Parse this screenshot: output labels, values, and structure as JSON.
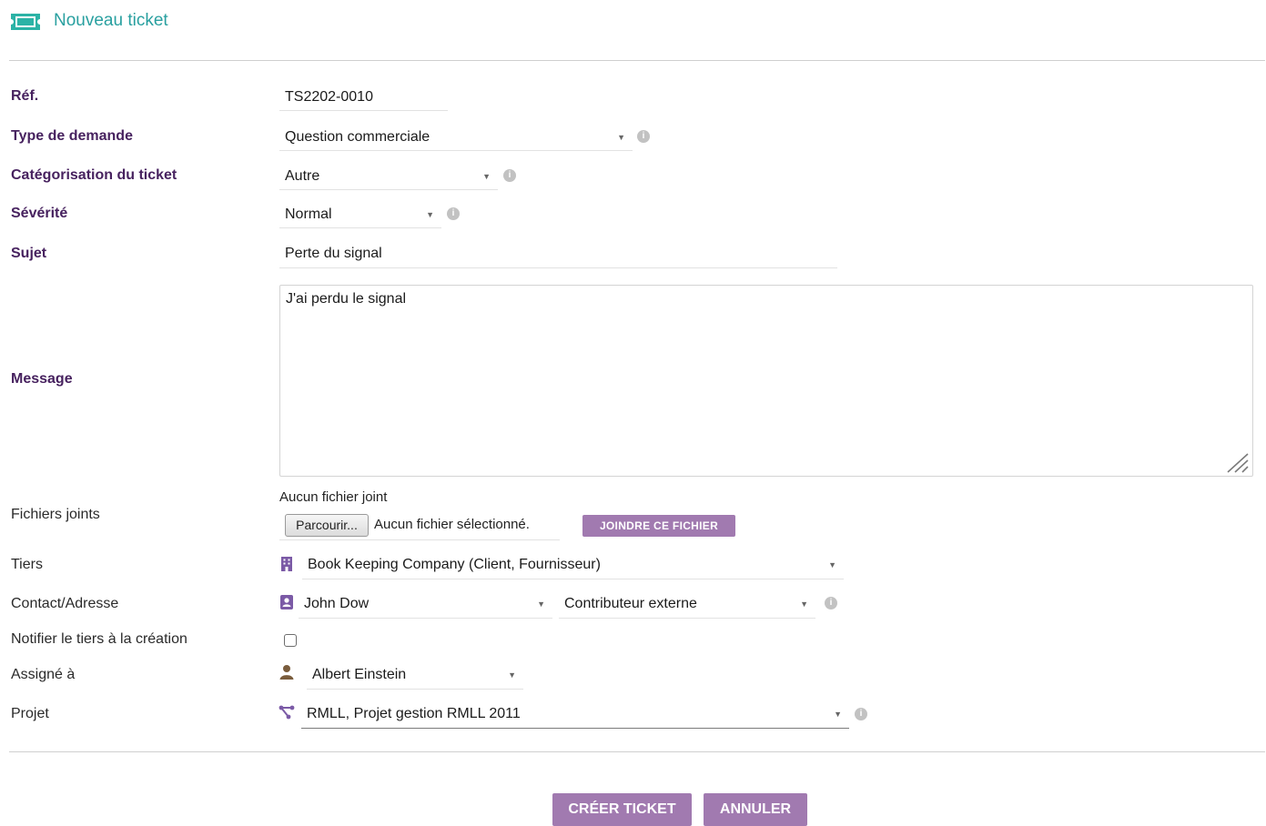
{
  "header": {
    "title": "Nouveau ticket",
    "icon": "ticket-icon",
    "accent": "#29a0a0"
  },
  "form": {
    "ref": {
      "label": "Réf.",
      "value": "TS2202-0010"
    },
    "type_demande": {
      "label": "Type de demande",
      "value": "Question commerciale"
    },
    "categorisation": {
      "label": "Catégorisation du ticket",
      "value": "Autre"
    },
    "severite": {
      "label": "Sévérité",
      "value": "Normal"
    },
    "sujet": {
      "label": "Sujet",
      "value": "Perte du signal"
    },
    "message": {
      "label": "Message",
      "value": "J'ai perdu le signal"
    },
    "fichiers": {
      "label": "Fichiers joints",
      "status": "Aucun fichier joint",
      "browse_label": "Parcourir...",
      "no_file": "Aucun fichier sélectionné.",
      "join_label": "JOINDRE CE FICHIER"
    },
    "tiers": {
      "label": "Tiers",
      "value": "Book Keeping Company (Client, Fournisseur)",
      "icon": "building-icon"
    },
    "contact": {
      "label": "Contact/Adresse",
      "value": "John Dow",
      "role": "Contributeur externe",
      "icon": "contact-card-icon"
    },
    "notifier": {
      "label": "Notifier le tiers à la création",
      "checked": false
    },
    "assigne": {
      "label": "Assigné à",
      "value": "Albert Einstein",
      "icon": "user-icon"
    },
    "projet": {
      "label": "Projet",
      "value": "RMLL, Projet gestion RMLL 2011",
      "icon": "project-icon"
    }
  },
  "actions": {
    "create_label": "CRÉER TICKET",
    "cancel_label": "ANNULER",
    "button_color": "#a17ab0"
  },
  "colors": {
    "required_label": "#47225f",
    "icon_purple": "#7b5aa6"
  }
}
